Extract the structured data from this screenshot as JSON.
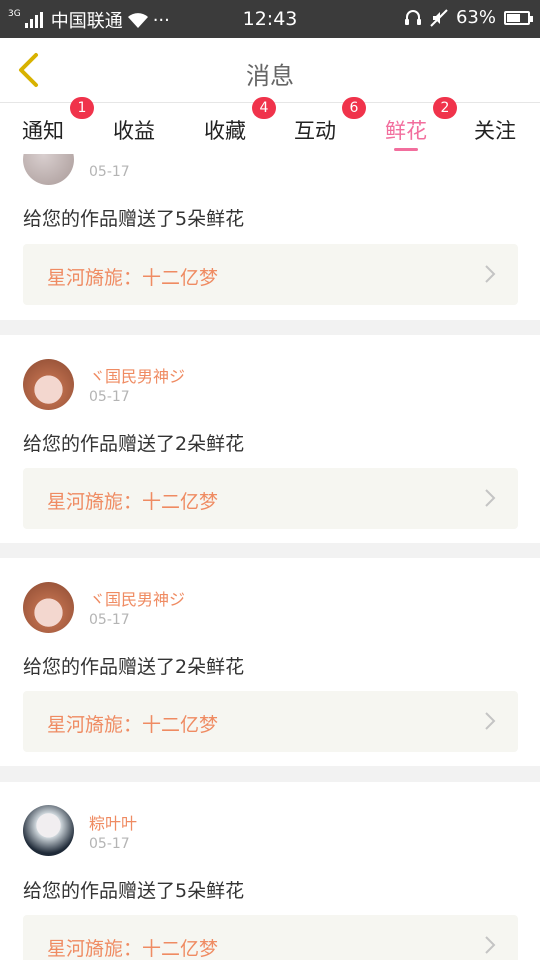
{
  "status_bar": {
    "network": "3G",
    "carrier": "中国联通",
    "more": "···",
    "time": "12:43",
    "battery": "63%",
    "battery_level": 0.63
  },
  "header": {
    "title": "消息"
  },
  "tabs": [
    {
      "label": "通知",
      "badge": "1"
    },
    {
      "label": "收益",
      "badge": ""
    },
    {
      "label": "收藏",
      "badge": "4"
    },
    {
      "label": "互动",
      "badge": "6"
    },
    {
      "label": "鲜花",
      "badge": "2",
      "active": true
    },
    {
      "label": "关注",
      "badge": ""
    }
  ],
  "messages": [
    {
      "user": "",
      "date": "05-17",
      "text": "给您的作品赠送了5朵鲜花",
      "work": "星河旖旎：十二亿梦"
    },
    {
      "user": "ヾ国民男神ジ",
      "date": "05-17",
      "text": "给您的作品赠送了2朵鲜花",
      "work": "星河旖旎：十二亿梦"
    },
    {
      "user": "ヾ国民男神ジ",
      "date": "05-17",
      "text": "给您的作品赠送了2朵鲜花",
      "work": "星河旖旎：十二亿梦"
    },
    {
      "user": "粽叶叶",
      "date": "05-17",
      "text": "给您的作品赠送了5朵鲜花",
      "work": "星河旖旎：十二亿梦"
    }
  ],
  "colors": {
    "accent": "#f26e9d",
    "badge": "#f0334b",
    "username": "#ef8b62",
    "back_arrow": "#d8b200"
  }
}
